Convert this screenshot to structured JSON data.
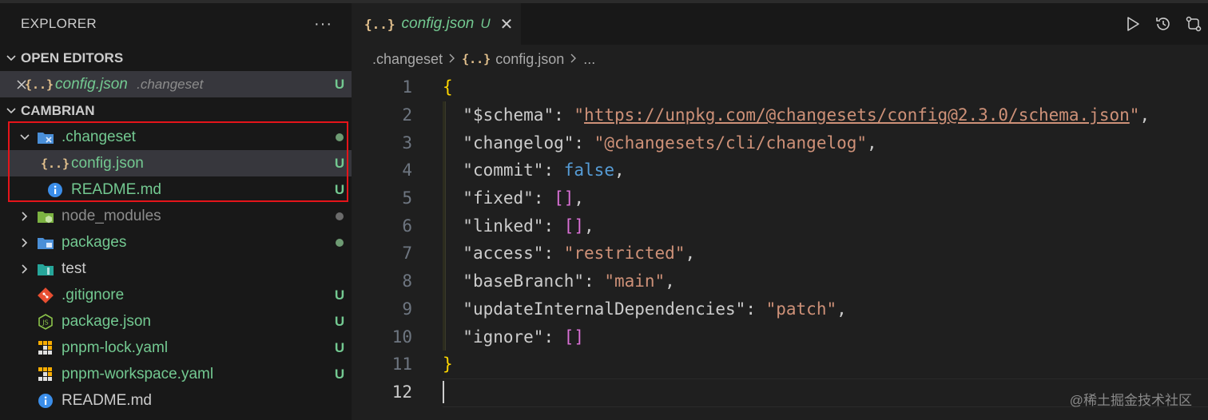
{
  "sidebar": {
    "title": "EXPLORER",
    "more": "···",
    "open_editors": {
      "label": "OPEN EDITORS",
      "item": {
        "icon": "{..}",
        "name": "config.json",
        "path": ".changeset",
        "status": "U"
      }
    },
    "workspace": {
      "label": "CAMBRIAN",
      "items": [
        {
          "type": "folder",
          "expanded": true,
          "name": ".changeset",
          "status": "dot",
          "icon": "folder-changeset-icon"
        },
        {
          "type": "file",
          "name": "config.json",
          "status": "U",
          "icon": "{..}"
        },
        {
          "type": "file",
          "name": "README.md",
          "status": "U",
          "icon": "i"
        },
        {
          "type": "folder",
          "name": "node_modules",
          "status": "dot",
          "icon": "folder-node-icon"
        },
        {
          "type": "folder",
          "name": "packages",
          "status": "dot",
          "icon": "folder-packages-icon"
        },
        {
          "type": "folder",
          "name": "test",
          "status": "",
          "icon": "folder-test-icon"
        },
        {
          "type": "file",
          "name": ".gitignore",
          "status": "U",
          "icon": "git-icon"
        },
        {
          "type": "file",
          "name": "package.json",
          "status": "U",
          "icon": "nodejs-icon"
        },
        {
          "type": "file",
          "name": "pnpm-lock.yaml",
          "status": "U",
          "icon": "pnpm-icon"
        },
        {
          "type": "file",
          "name": "pnpm-workspace.yaml",
          "status": "U",
          "icon": "pnpm-icon"
        },
        {
          "type": "file",
          "name": "README.md",
          "status": "",
          "icon": "i"
        }
      ]
    }
  },
  "editor": {
    "tab": {
      "icon": "{..}",
      "name": "config.json",
      "status": "U",
      "close": "✕"
    },
    "breadcrumb": {
      "folder": ".changeset",
      "icon": "{..}",
      "file": "config.json",
      "more": "..."
    },
    "line_numbers": [
      "1",
      "2",
      "3",
      "4",
      "5",
      "6",
      "7",
      "8",
      "9",
      "10",
      "11",
      "12"
    ],
    "code": {
      "l1": "{",
      "schema_key": "\"$schema\"",
      "schema_q1": "\"",
      "schema_url": "https://unpkg.com/@changesets/config@2.3.0/schema.json",
      "schema_q2": "\"",
      "changelog_key": "\"changelog\"",
      "changelog_val": "\"@changesets/cli/changelog\"",
      "commit_key": "\"commit\"",
      "commit_val": "false",
      "fixed_key": "\"fixed\"",
      "linked_key": "\"linked\"",
      "access_key": "\"access\"",
      "access_val": "\"restricted\"",
      "base_key": "\"baseBranch\"",
      "base_val": "\"main\"",
      "update_key": "\"updateInternalDependencies\"",
      "update_val": "\"patch\"",
      "ignore_key": "\"ignore\"",
      "l11": "}",
      "empty_arr": "[]",
      "colon": ": ",
      "comma": ","
    },
    "watermark": "@稀土掘金技术社区"
  }
}
